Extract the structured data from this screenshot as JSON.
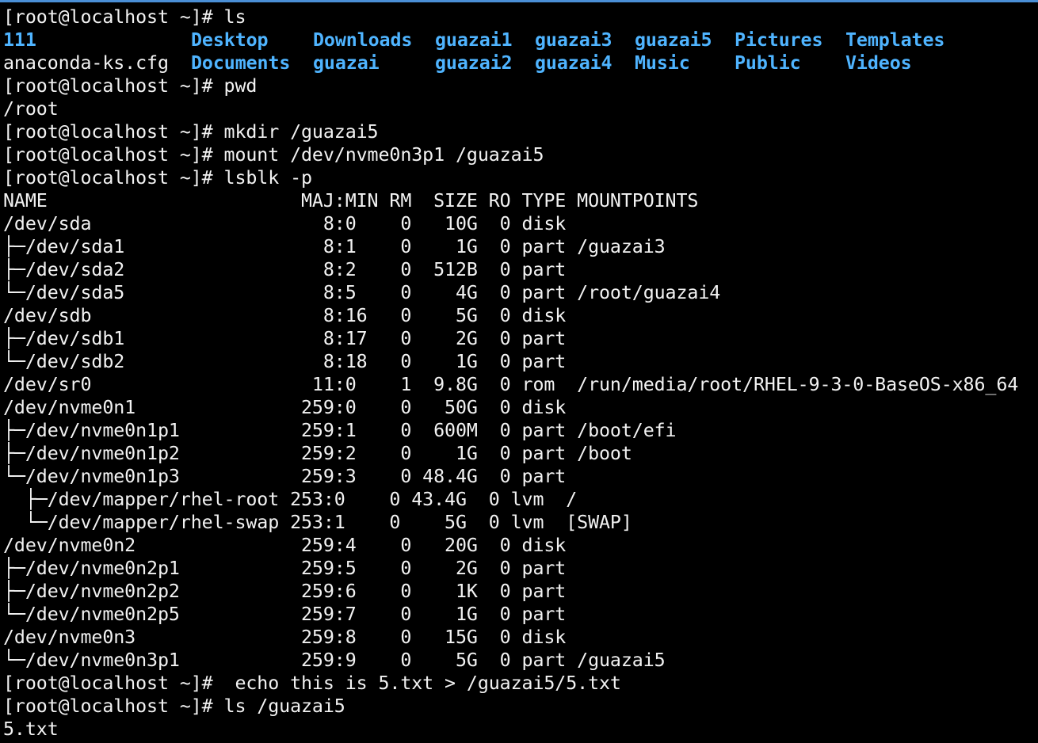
{
  "colors": {
    "background": "#000000",
    "text": "#f2f2f2",
    "directory": "#4fb4ff",
    "top_border": "#4a8fd6"
  },
  "prompt": "[root@localhost ~]#",
  "commands": {
    "ls": " ls",
    "pwd": " pwd",
    "mkdir": " mkdir /guazai5",
    "mount": " mount /dev/nvme0n3p1 /guazai5",
    "lsblk": " lsblk -p",
    "echo": "  echo this is 5.txt > /guazai5/5.txt",
    "ls_guazai5": " ls /guazai5"
  },
  "ls_output": {
    "row1": [
      "111",
      "Desktop",
      "Downloads",
      "guazai1",
      "guazai3",
      "guazai5",
      "Pictures",
      "Templates"
    ],
    "row2": [
      "anaconda-ks.cfg",
      "Documents",
      "guazai",
      "guazai2",
      "guazai4",
      "Music",
      "Public",
      "Videos"
    ]
  },
  "pwd_output": "/root",
  "lsblk_lines": [
    "NAME                       MAJ:MIN RM  SIZE RO TYPE MOUNTPOINTS",
    "/dev/sda                     8:0    0   10G  0 disk ",
    "├─/dev/sda1                  8:1    0    1G  0 part /guazai3",
    "├─/dev/sda2                  8:2    0  512B  0 part ",
    "└─/dev/sda5                  8:5    0    4G  0 part /root/guazai4",
    "/dev/sdb                     8:16   0    5G  0 disk ",
    "├─/dev/sdb1                  8:17   0    2G  0 part ",
    "└─/dev/sdb2                  8:18   0    1G  0 part ",
    "/dev/sr0                    11:0    1  9.8G  0 rom  /run/media/root/RHEL-9-3-0-BaseOS-x86_64",
    "/dev/nvme0n1               259:0    0   50G  0 disk ",
    "├─/dev/nvme0n1p1           259:1    0  600M  0 part /boot/efi",
    "├─/dev/nvme0n1p2           259:2    0    1G  0 part /boot",
    "└─/dev/nvme0n1p3           259:3    0 48.4G  0 part ",
    "  ├─/dev/mapper/rhel-root 253:0    0 43.4G  0 lvm  /",
    "  └─/dev/mapper/rhel-swap 253:1    0    5G  0 lvm  [SWAP]",
    "/dev/nvme0n2               259:4    0   20G  0 disk ",
    "├─/dev/nvme0n2p1           259:5    0    2G  0 part ",
    "├─/dev/nvme0n2p2           259:6    0    1K  0 part ",
    "└─/dev/nvme0n2p5           259:7    0    1G  0 part ",
    "/dev/nvme0n3               259:8    0   15G  0 disk ",
    "└─/dev/nvme0n3p1           259:9    0    5G  0 part /guazai5"
  ],
  "ls_guazai5_output": "5.txt"
}
